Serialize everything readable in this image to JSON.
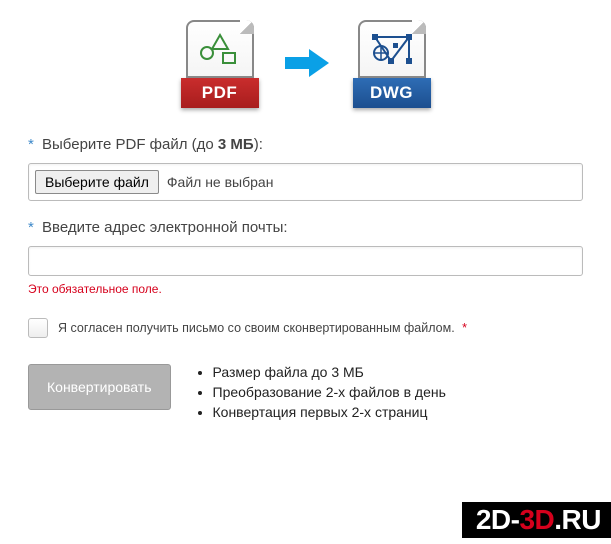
{
  "hero": {
    "from_label": "PDF",
    "to_label": "DWG"
  },
  "file_field": {
    "label_prefix": "Выберите PDF файл (до ",
    "label_bold": "3 МБ",
    "label_suffix": "):",
    "button": "Выберите файл",
    "placeholder": "Файл не выбран"
  },
  "email_field": {
    "label": "Введите адрес электронной почты:",
    "value": "",
    "error": "Это обязательное поле."
  },
  "consent": {
    "text": "Я согласен получить письмо со своим сконвертированным файлом."
  },
  "submit_label": "Конвертировать",
  "notes": [
    "Размер файла до 3 МБ",
    "Преобразование 2-х файлов в день",
    "Конвертация первых 2-х страниц"
  ],
  "watermark": {
    "a": "2D-",
    "b": "3D",
    "c": ".RU"
  },
  "asterisk": "*"
}
